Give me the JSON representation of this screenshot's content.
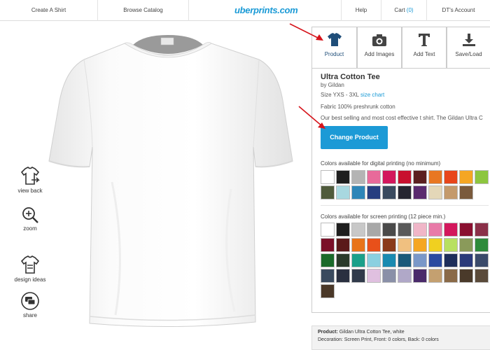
{
  "nav": {
    "create": "Create A Shirt",
    "browse": "Browse Catalog",
    "logo": "uberprints.com",
    "help": "Help",
    "cart_label": "Cart",
    "cart_count": "(0)",
    "account": "DT's Account"
  },
  "left_tools": {
    "view_back": "view back",
    "zoom": "zoom",
    "design_ideas": "design ideas",
    "share": "share"
  },
  "tabs": {
    "product": "Product",
    "add_images": "Add Images",
    "add_text": "Add Text",
    "save_load": "Save/Load"
  },
  "product": {
    "title": "Ultra Cotton Tee",
    "by": "by Gildan",
    "size_label": "Size",
    "size_range": "YXS - 3XL",
    "size_chart": "size chart",
    "fabric_label": "Fabric",
    "fabric": "100% preshrunk cotton",
    "description": "Our best selling and most cost effective t shirt. The Gildan Ultra C",
    "change_button": "Change Product",
    "digital_title": "Colors available for digital printing (no minimum)",
    "screen_title": "Colors available for screen printing (12 piece min.)"
  },
  "digital_colors": [
    "#ffffff",
    "#1e1e1e",
    "#b4b4b4",
    "#e86a9a",
    "#d3175c",
    "#c8102e",
    "#5b1f1f",
    "#e87722",
    "#e8451a",
    "#f5a623",
    "#8dc63f",
    "#4f5a3b",
    "#a8d8e0",
    "#2e86b8",
    "#273e80",
    "#3a4a5e",
    "#262630",
    "#5a2a6e",
    "#e4d7b8",
    "#c49a6c",
    "#7a5a3c"
  ],
  "screen_colors": [
    "#ffffff",
    "#1e1e1e",
    "#c8c8c8",
    "#a8a8a8",
    "#4a4a4a",
    "#5a5a5a",
    "#f0b6c8",
    "#e87aa8",
    "#d3175c",
    "#8a1030",
    "#8a3048",
    "#7a1028",
    "#5a1a1a",
    "#e8741a",
    "#e8501a",
    "#8a3a1a",
    "#f0c080",
    "#f5a623",
    "#f0d020",
    "#b8e060",
    "#8a9a5a",
    "#2e8a3a",
    "#1a6a2a",
    "#2a3a2a",
    "#1aa08a",
    "#8ad0e0",
    "#1a8ab0",
    "#1a5a7a",
    "#7a98c8",
    "#2a4aa0",
    "#1e2e5a",
    "#2a3a7a",
    "#3a4a6a",
    "#3a4a5e",
    "#2a3040",
    "#303a4a",
    "#e0c0e0",
    "#8a90a8",
    "#b0a8c8",
    "#4a2a6a",
    "#c4a070",
    "#8a6a48",
    "#4a3a2a",
    "#5a4a3a",
    "#4a3828"
  ],
  "footer": {
    "product_label": "Product:",
    "product_value": "Gildan Ultra Cotton Tee, white",
    "decoration_label": "Decoration:",
    "decoration_value": "Screen Print, Front: 0 colors, Back: 0 colors"
  }
}
